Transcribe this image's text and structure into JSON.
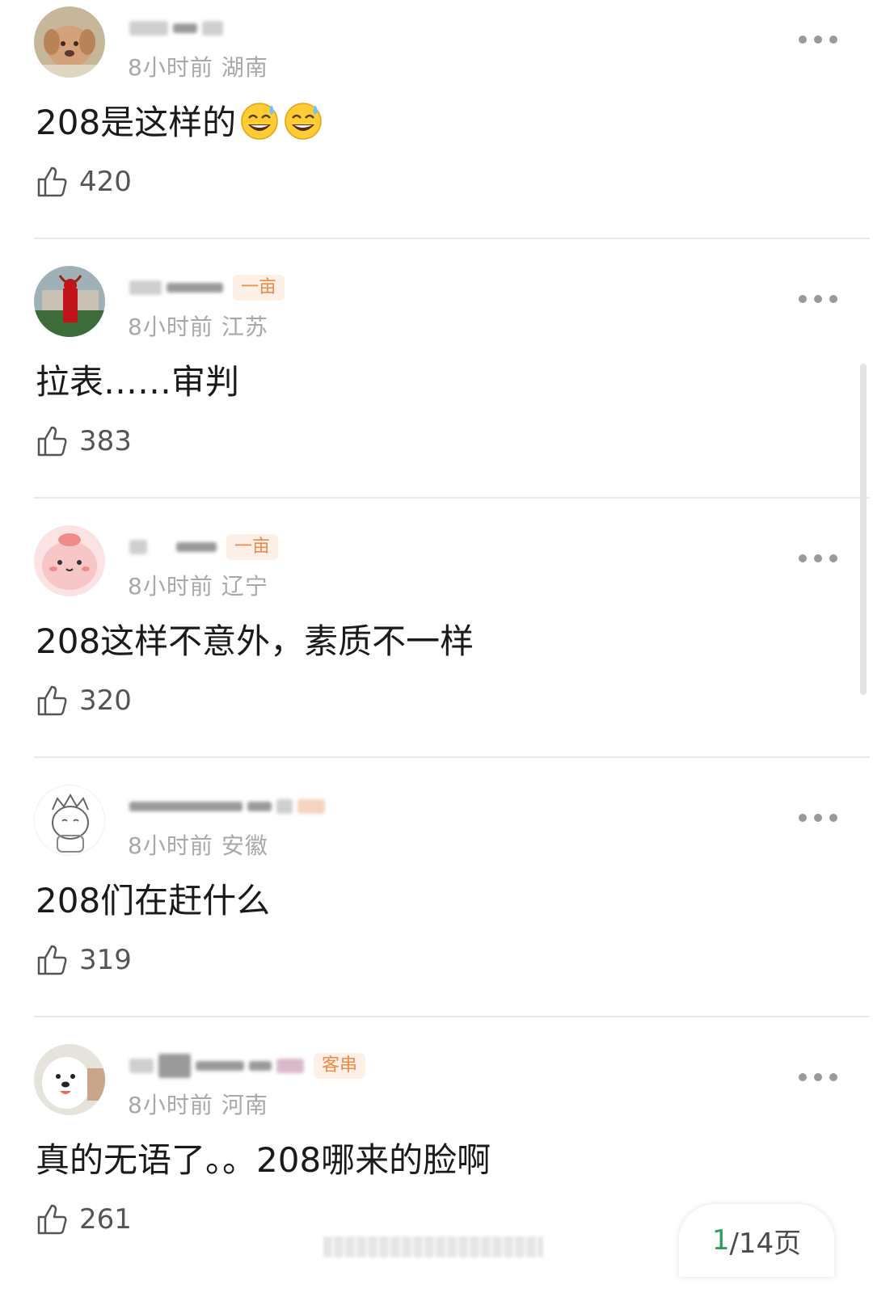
{
  "comments": [
    {
      "name_badge": "",
      "time": "8小时前",
      "location": "湖南",
      "text": "208是这样的",
      "emojis": [
        "😅",
        "😅"
      ],
      "likes": "420",
      "avatar_icon": "puppy-avatar"
    },
    {
      "name_badge": "一亩",
      "time": "8小时前",
      "location": "江苏",
      "text": "拉表……审判",
      "emojis": [],
      "likes": "383",
      "avatar_icon": "red-figure-avatar"
    },
    {
      "name_badge": "一亩",
      "time": "8小时前",
      "location": "辽宁",
      "text": "208这样不意外，素质不一样",
      "emojis": [],
      "likes": "320",
      "avatar_icon": "pink-blob-avatar"
    },
    {
      "name_badge": "",
      "time": "8小时前",
      "location": "安徽",
      "text": "208们在赶什么",
      "emojis": [],
      "likes": "319",
      "avatar_icon": "sketch-character-avatar"
    },
    {
      "name_badge": "客串",
      "time": "8小时前",
      "location": "河南",
      "text": "真的无语了。。208哪来的脸啊",
      "emojis": [],
      "likes": "261",
      "avatar_icon": "white-dog-avatar"
    }
  ],
  "pager": {
    "current": "1",
    "rest": "/14页"
  },
  "colors": {
    "badge": "#ee8a4a",
    "pager_current": "#2e9e5b",
    "meta": "#a8a8a8"
  }
}
